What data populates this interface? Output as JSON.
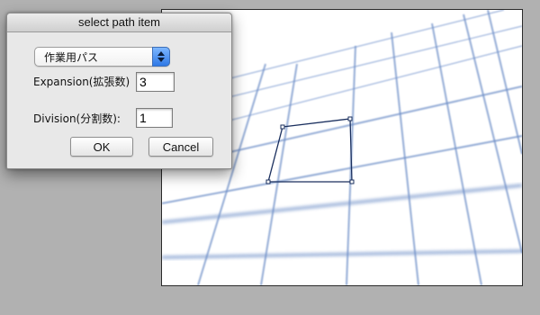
{
  "dialog": {
    "title": "select path item",
    "dropdown": {
      "selected": "作業用パス",
      "icon": "up-down-arrows-icon"
    },
    "expansion": {
      "label": "Expansion(拡張数)",
      "value": "3"
    },
    "division": {
      "label": "Division(分割数):",
      "value": "1"
    },
    "buttons": {
      "ok": "OK",
      "cancel": "Cancel"
    }
  },
  "canvas": {
    "background": "#ffffff",
    "grid_color": "#6f90c8",
    "path_color": "#1a2f5e"
  }
}
